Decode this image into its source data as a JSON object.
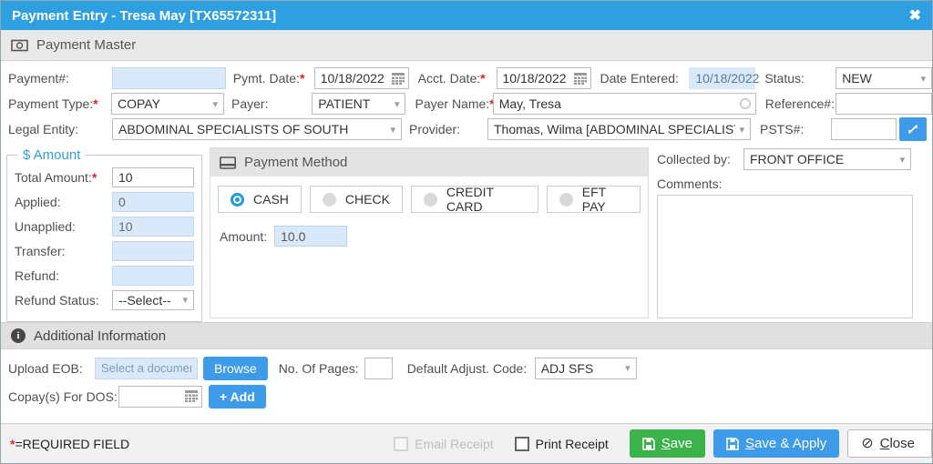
{
  "colors": {
    "titlebar_blue": "#2e9fe0",
    "button_blue": "#3d9be9",
    "button_green": "#3cb24a",
    "readonly_field_bg": "#d9e9f9",
    "radio_selected": "#1f9ed9",
    "required_red": "#e02020"
  },
  "ui": {
    "required_marker": "*",
    "close_x": "✖",
    "dropdown_arrow": "▾"
  },
  "window": {
    "title": "Payment Entry - Tresa May [TX65572311]"
  },
  "master": {
    "title": "Payment Master",
    "payment_no_label": "Payment#:",
    "payment_no_value": "",
    "pymt_date_label": "Pymt. Date:",
    "pymt_date_value": "10/18/2022",
    "acct_date_label": "Acct. Date:",
    "acct_date_value": "10/18/2022",
    "date_entered_label": "Date Entered:",
    "date_entered_value": "10/18/2022",
    "status_label": "Status:",
    "status_value": "NEW",
    "payment_type_label": "Payment Type:",
    "payment_type_value": "COPAY",
    "payer_label": "Payer:",
    "payer_value": "PATIENT",
    "payer_name_label": "Payer Name:",
    "payer_name_value": "May, Tresa",
    "reference_label": "Reference#:",
    "reference_value": "",
    "legal_entity_label": "Legal Entity:",
    "legal_entity_value": "ABDOMINAL SPECIALISTS OF SOUTH",
    "provider_label": "Provider:",
    "provider_value": "Thomas, Wilma [ABDOMINAL SPECIALISTS O",
    "psts_label": "PSTS#:",
    "psts_value": ""
  },
  "amount": {
    "title": "$ Amount",
    "total_label": "Total Amount:",
    "total_value": "10",
    "applied_label": "Applied:",
    "applied_value": "0",
    "unapplied_label": "Unapplied:",
    "unapplied_value": "10",
    "transfer_label": "Transfer:",
    "transfer_value": "",
    "refund_label": "Refund:",
    "refund_value": "",
    "refund_status_label": "Refund Status:",
    "refund_status_value": "--Select--"
  },
  "payment_method": {
    "title": "Payment Method",
    "options": [
      {
        "label": "CASH",
        "selected": true
      },
      {
        "label": "CHECK",
        "selected": false
      },
      {
        "label": "CREDIT CARD",
        "selected": false
      },
      {
        "label": "EFT PAY",
        "selected": false
      }
    ],
    "amount_label": "Amount:",
    "amount_value": "10.0"
  },
  "collection": {
    "collected_by_label": "Collected by:",
    "collected_by_value": "FRONT OFFICE",
    "comments_label": "Comments:",
    "comments_value": ""
  },
  "additional": {
    "title": "Additional Information",
    "upload_eob_label": "Upload EOB:",
    "upload_eob_placeholder": "Select a document",
    "browse_label": "Browse",
    "pages_label": "No. Of Pages:",
    "pages_value": "",
    "adjust_code_label": "Default Adjust. Code:",
    "adjust_code_value": "ADJ SFS",
    "copay_dos_label": "Copay(s) For DOS:",
    "copay_dos_value": "",
    "add_label": "+ Add"
  },
  "footer": {
    "required_text": "=REQUIRED FIELD",
    "email_receipt_label": "Email Receipt",
    "print_receipt_label": "Print Receipt",
    "save_label": "Save",
    "save_apply_label": "Save & Apply",
    "close_label": "Close"
  }
}
